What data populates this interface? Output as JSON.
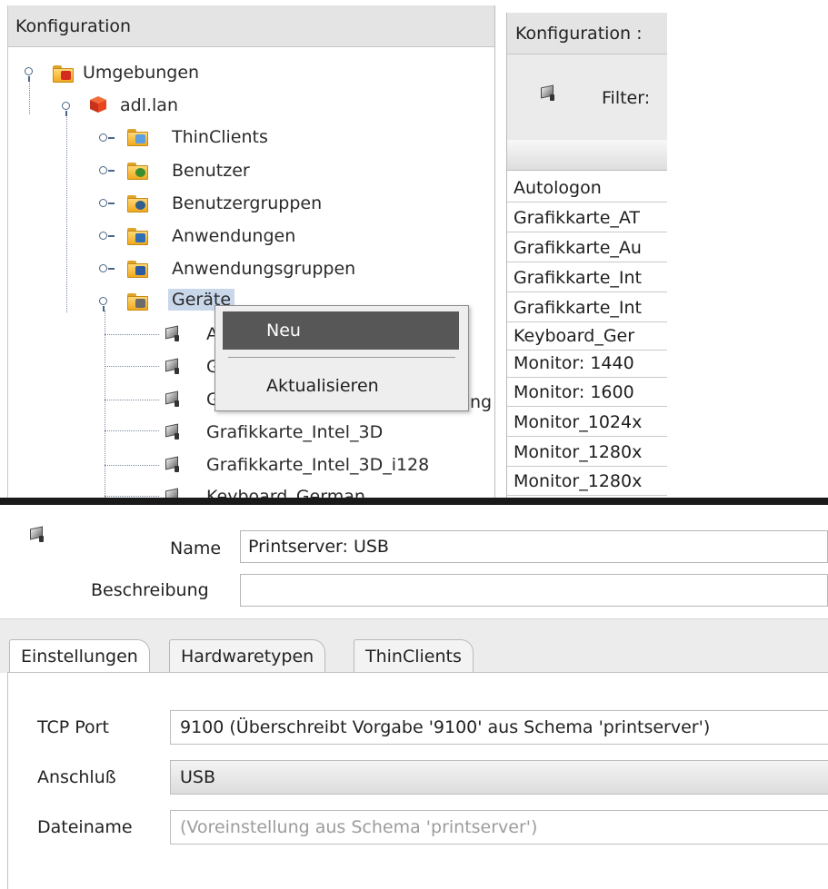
{
  "config_panel": {
    "title": "Konfiguration",
    "tree": {
      "root": "Umgebungen",
      "domain": "adl.lan",
      "groups": [
        "ThinClients",
        "Benutzer",
        "Benutzergruppen",
        "Anwendungen",
        "Anwendungsgruppen",
        "Geräte"
      ],
      "devices_visible": [
        "A",
        "G",
        "G",
        "Grafikkarte_Intel_3D",
        "Grafikkarte_Intel_3D_i128",
        "Keyboard_German"
      ],
      "partial_text": "ng"
    }
  },
  "context_menu": {
    "items": [
      "Neu",
      "Aktualisieren"
    ],
    "highlighted": "Neu"
  },
  "right_panel": {
    "title": "Konfiguration :",
    "filter_label": "Filter:",
    "rows": [
      "Autologon",
      "Grafikkarte_AT",
      "Grafikkarte_Au",
      "Grafikkarte_Int",
      "Grafikkarte_Int",
      "Keyboard_Ger",
      "Monitor: 1440",
      "Monitor: 1600",
      "Monitor_1024x",
      "Monitor_1280x",
      "Monitor_1280x"
    ]
  },
  "dialog": {
    "name_label": "Name",
    "name_value": "Printserver: USB",
    "description_label": "Beschreibung",
    "description_value": "",
    "tabs": [
      "Einstellungen",
      "Hardwaretypen",
      "ThinClients"
    ],
    "active_tab": "Einstellungen",
    "properties": {
      "tcp_port_label": "TCP Port",
      "tcp_port_value": "9100 (Überschreibt Vorgabe '9100' aus Schema 'printserver')",
      "connection_label": "Anschluß",
      "connection_value": "USB",
      "filename_label": "Dateiname",
      "filename_placeholder": "(Voreinstellung aus Schema 'printserver')"
    }
  },
  "icons": {
    "folder_color": "#f2a91c",
    "domain_cube_color": "#d9361a",
    "device_icon": "printer-device-icon",
    "tree_handle_color": "#4a6587"
  }
}
